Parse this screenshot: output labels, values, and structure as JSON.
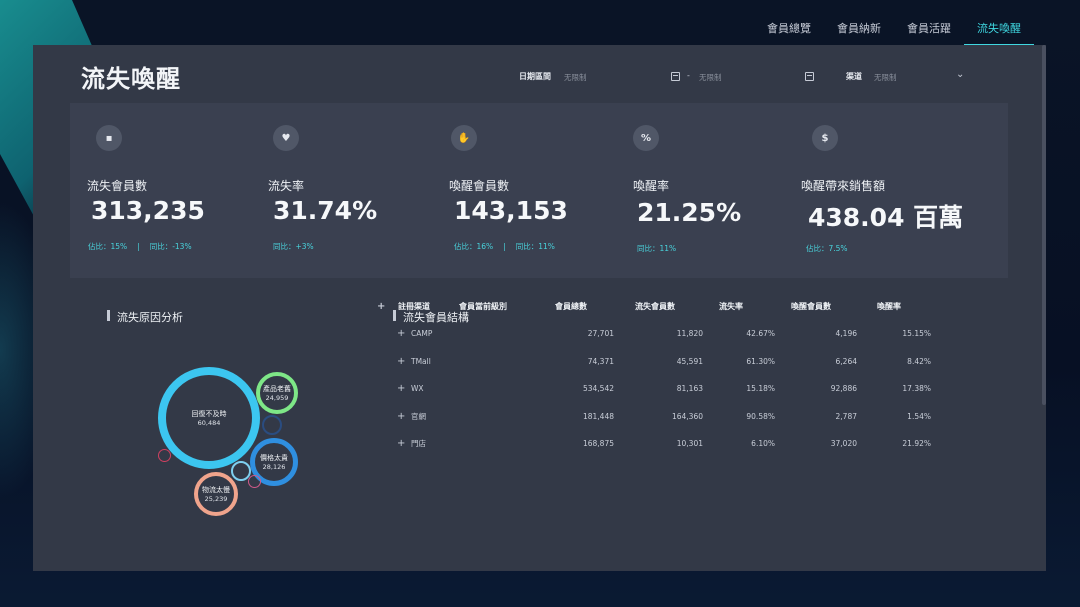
{
  "nav": {
    "tabs": [
      {
        "label": "會員總覽",
        "active": false
      },
      {
        "label": "會員納新",
        "active": false
      },
      {
        "label": "會員活躍",
        "active": false
      },
      {
        "label": "流失喚醒",
        "active": true
      }
    ]
  },
  "page": {
    "title": "流失喚醒"
  },
  "filters": {
    "date_label": "日期區間",
    "date_from_placeholder": "无限制",
    "date_sep": "-",
    "date_to_placeholder": "无限制",
    "channel_label": "渠道",
    "channel_placeholder": "无限制"
  },
  "kpis": [
    {
      "icon": "id-card-icon",
      "glyph": "▪",
      "label": "流失會員數",
      "value": "313,235",
      "sub1": "佔比：15%",
      "sep": "|",
      "sub2": "同比：-13%"
    },
    {
      "icon": "heart-icon",
      "glyph": "♥",
      "label": "流失率",
      "value": "31.74%",
      "sub1": "同比：+3%",
      "sep": "",
      "sub2": ""
    },
    {
      "icon": "hand-coin-icon",
      "glyph": "✋",
      "label": "喚醒會員數",
      "value": "143,153",
      "sub1": "佔比：16%",
      "sep": "|",
      "sub2": "同比：11%"
    },
    {
      "icon": "percent-icon",
      "glyph": "%",
      "label": "喚醒率",
      "value": "21.25%",
      "sub1": "同比：11%",
      "sep": "",
      "sub2": ""
    },
    {
      "icon": "dollar-coin-icon",
      "glyph": "$",
      "label": "喚醒帶來銷售額",
      "value": "438.04 百萬",
      "sub1": "佔比：7.5%",
      "sep": "",
      "sub2": ""
    }
  ],
  "reasons": {
    "title": "流失原因分析",
    "bubbles": [
      {
        "name": "回復不及時",
        "value": "60,484",
        "color": "#3cc6f0"
      },
      {
        "name": "產品老舊",
        "value": "24,959",
        "color": "#7ee787"
      },
      {
        "name": "價格太貴",
        "value": "28,126",
        "color": "#2f8fe0"
      },
      {
        "name": "物流太慢",
        "value": "25,239",
        "color": "#f0a48c"
      }
    ]
  },
  "structure": {
    "title": "流失會員結構",
    "columns": [
      "註冊渠道",
      "會員當前級別",
      "會員總數",
      "流失會員數",
      "流失率",
      "喚醒會員數",
      "喚醒率"
    ],
    "rows": [
      {
        "channel": "CAMP",
        "level": "",
        "total": "27,701",
        "lost": "11,820",
        "lost_rate": "42.67%",
        "awake": "4,196",
        "awake_rate": "15.15%"
      },
      {
        "channel": "TMall",
        "level": "",
        "total": "74,371",
        "lost": "45,591",
        "lost_rate": "61.30%",
        "awake": "6,264",
        "awake_rate": "8.42%"
      },
      {
        "channel": "WX",
        "level": "",
        "total": "534,542",
        "lost": "81,163",
        "lost_rate": "15.18%",
        "awake": "92,886",
        "awake_rate": "17.38%"
      },
      {
        "channel": "官網",
        "level": "",
        "total": "181,448",
        "lost": "164,360",
        "lost_rate": "90.58%",
        "awake": "2,787",
        "awake_rate": "1.54%"
      },
      {
        "channel": "門店",
        "level": "",
        "total": "168,875",
        "lost": "10,301",
        "lost_rate": "6.10%",
        "awake": "37,020",
        "awake_rate": "21.92%"
      }
    ]
  }
}
